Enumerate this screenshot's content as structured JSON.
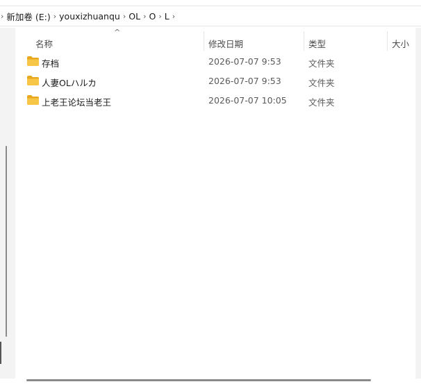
{
  "breadcrumb": {
    "items": [
      "新加卷 (E:)",
      "youxizhuanqu",
      "OL",
      "O",
      "L"
    ]
  },
  "columns": {
    "name": "名称",
    "date": "修改日期",
    "type": "类型",
    "size": "大小"
  },
  "files": [
    {
      "name": "存档",
      "date": "2026-07-07 9:53",
      "type": "文件夹"
    },
    {
      "name": "人妻OLハルカ",
      "date": "2026-07-07 9:53",
      "type": "文件夹"
    },
    {
      "name": "上老王论坛当老王",
      "date": "2026-07-07 10:05",
      "type": "文件夹"
    }
  ],
  "colors": {
    "folder": "#f8c646",
    "folder_dark": "#e8a820"
  },
  "icons": {
    "folder": "folder-icon",
    "sort": "sort-ascending-icon",
    "separator": "chevron-right-icon"
  }
}
